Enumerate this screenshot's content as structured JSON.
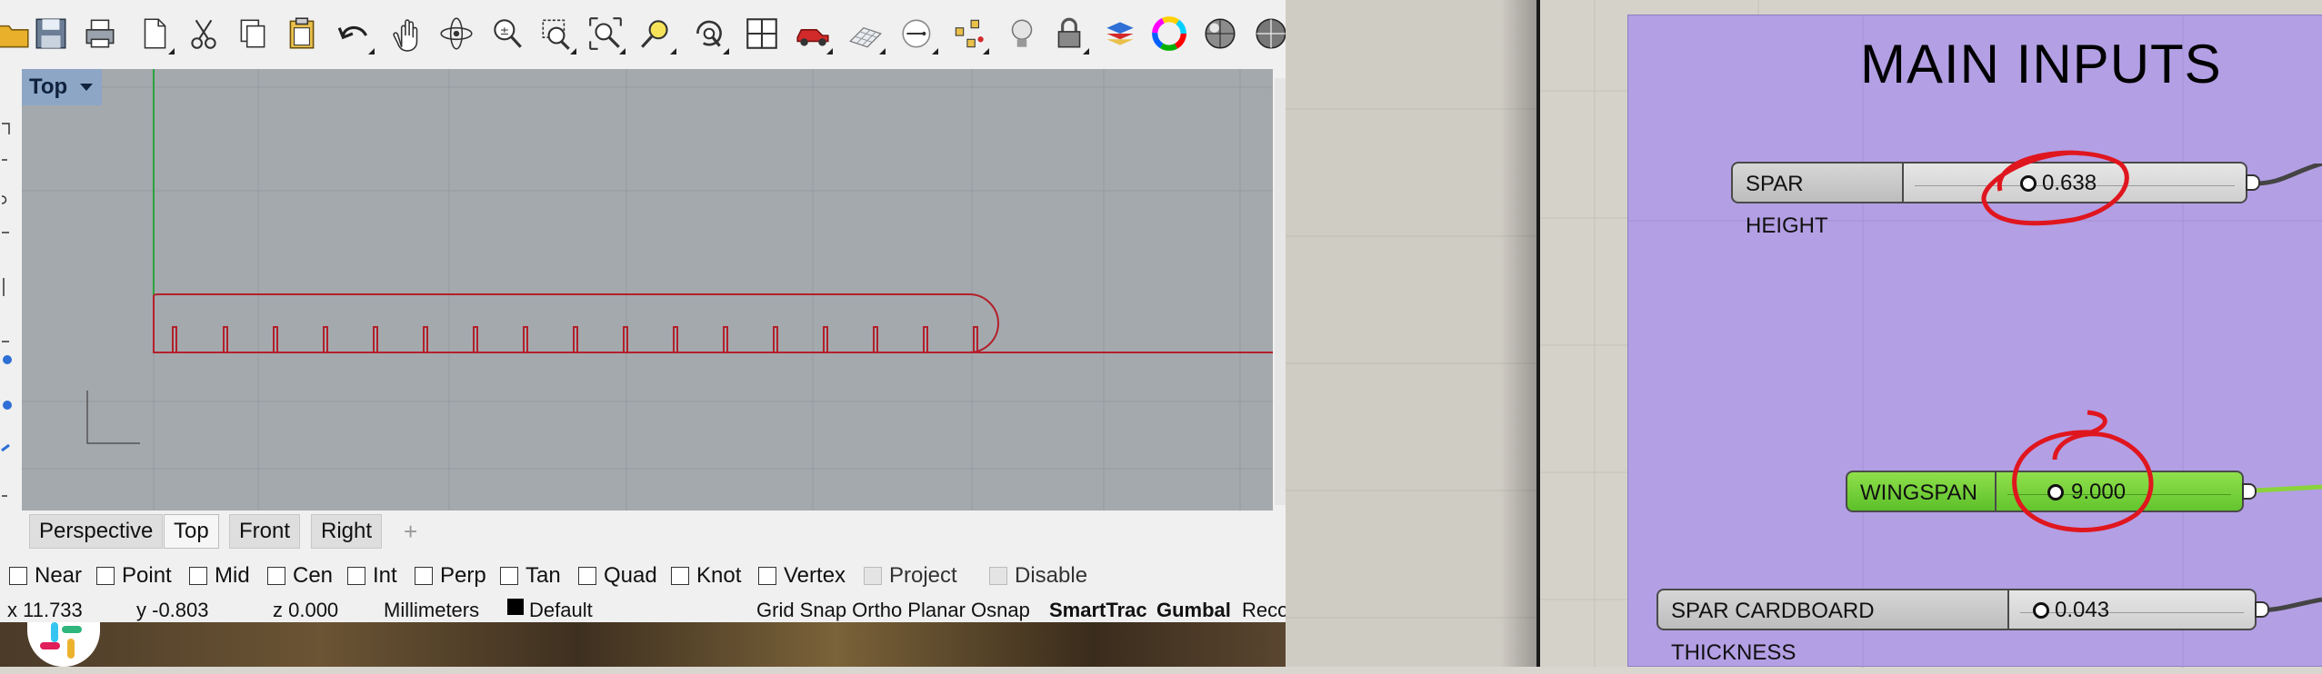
{
  "viewport": {
    "name": "Top",
    "tabs": [
      "Perspective",
      "Top",
      "Front",
      "Right"
    ],
    "active_tab": "Top",
    "add_tab_symbol": "+"
  },
  "osnap": {
    "items": [
      "Near",
      "Point",
      "Mid",
      "Cen",
      "Int",
      "Perp",
      "Tan",
      "Quad",
      "Knot",
      "Vertex",
      "Project",
      "Disable"
    ]
  },
  "status": {
    "x": "x 11.733",
    "y": "y -0.803",
    "z": "z 0.000",
    "units": "Millimeters",
    "layer": "Default",
    "modes": "Grid Snap Ortho Planar Osnap",
    "smarttrack": "SmartTrac",
    "gumball": "Gumbal",
    "record": "Reco"
  },
  "grasshopper": {
    "group_title": "MAIN INPUTS",
    "sliders": [
      {
        "label": "SPAR HEIGHT",
        "value": "0.638"
      },
      {
        "label": "WINGSPAN",
        "value": "9.000"
      },
      {
        "label": "SPAR CARDBOARD THICKNESS",
        "value": "0.043"
      }
    ]
  },
  "colors": {
    "group": "#b39fe4",
    "slider_selected": "#7fd83c",
    "annotation": "#e0161e",
    "viewport_bg": "#a4a9ae",
    "curve": "#b3202a"
  },
  "icons": [
    "open-icon",
    "save-icon",
    "print-icon",
    "new-page-icon",
    "cut-icon",
    "copy-icon",
    "paste-icon",
    "undo-icon",
    "pan-icon",
    "rotate-view-icon",
    "zoom-icon",
    "zoom-window-icon",
    "zoom-extents-icon",
    "zoom-selected-icon",
    "rotate-camera-icon",
    "grid-view-icon",
    "car-icon",
    "grid-options-icon",
    "cplane-icon",
    "shape-points-icon",
    "light-bulb-icon",
    "lock-icon",
    "layer-icon",
    "color-wheel-icon",
    "render-sphere-icon",
    "render-sphere-2-icon"
  ]
}
